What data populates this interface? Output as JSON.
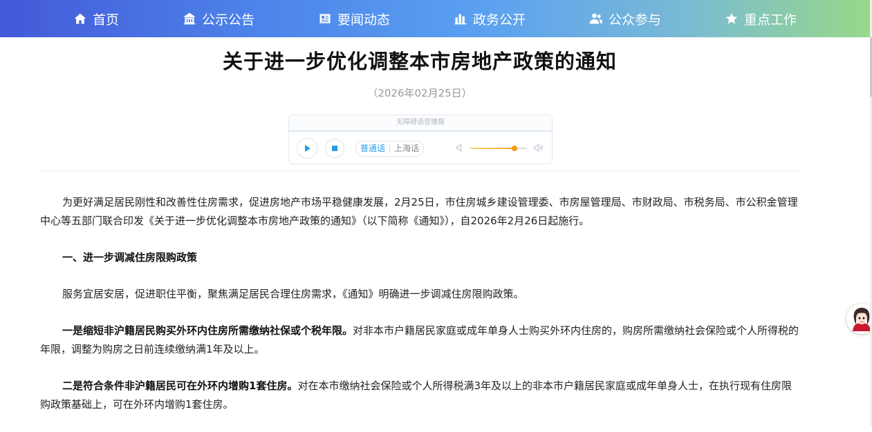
{
  "nav": {
    "items": [
      {
        "label": "首页",
        "icon": "home-icon"
      },
      {
        "label": "公示公告",
        "icon": "building-icon"
      },
      {
        "label": "要闻动态",
        "icon": "newspaper-icon"
      },
      {
        "label": "政务公开",
        "icon": "bar-chart-icon"
      },
      {
        "label": "公众参与",
        "icon": "users-icon"
      },
      {
        "label": "重点工作",
        "icon": "star-icon"
      }
    ]
  },
  "article": {
    "title": "关于进一步优化调整本市房地产政策的通知",
    "date": "（2026年02月25日）"
  },
  "player": {
    "header": "无障碍语音播报",
    "lang_active": "普通话",
    "lang_other": "上海话",
    "volume": 0.78,
    "accent_color": "#2a9ce8",
    "volume_color": "#f5a623"
  },
  "content": {
    "p1": "为更好满足居民刚性和改善性住房需求，促进房地产市场平稳健康发展，2月25日，市住房城乡建设管理委、市房屋管理局、市财政局、市税务局、市公积金管理中心等五部门联合印发《关于进一步优化调整本市房地产政策的通知》（以下简称《通知》），自2026年2月26日起施行。",
    "h1": "一、进一步调减住房限购政策",
    "p2": "服务宜居安居，促进职住平衡，聚焦满足居民合理住房需求，《通知》明确进一步调减住房限购政策。",
    "p3_bold": "一是缩短非沪籍居民购买外环内住房所需缴纳社保或个税年限。",
    "p3_text": "对非本市户籍居民家庭或成年单身人士购买外环内住房的，购房所需缴纳社会保险或个人所得税的年限，调整为购房之日前连续缴纳满1年及以上。",
    "p4_bold": "二是符合条件非沪籍居民可在外环内增购1套住房。",
    "p4_text": "对在本市缴纳社会保险或个人所得税满3年及以上的非本市户籍居民家庭或成年单身人士，在执行现有住房限购政策基础上，可在外环内增购1套住房。"
  },
  "float": {
    "icon": "avatar-assistant-icon"
  }
}
